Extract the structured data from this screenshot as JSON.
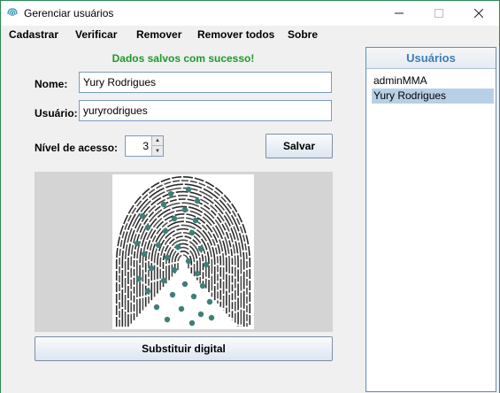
{
  "window": {
    "title": "Gerenciar usuários"
  },
  "menu": {
    "items": [
      "Cadastrar",
      "Verificar",
      "Remover",
      "Remover todos",
      "Sobre"
    ]
  },
  "form": {
    "status_message": "Dados salvos com sucesso!",
    "name_label": "Nome:",
    "name_value": "Yury Rodrigues",
    "username_label": "Usuário:",
    "username_value": "yuryrodrigues",
    "access_label": "Nível de acesso:",
    "access_value": "3",
    "save_label": "Salvar",
    "replace_fingerprint_label": "Substituir digital"
  },
  "users": {
    "header": "Usuários",
    "items": [
      {
        "label": "adminMMA",
        "selected": false
      },
      {
        "label": "Yury Rodrigues",
        "selected": true
      }
    ]
  },
  "colors": {
    "status_green": "#1e9a2a",
    "accent_blue": "#3d7cb8",
    "selection": "#b9cfe6",
    "minutia_marker": "#3f7f78"
  },
  "icons": {
    "app": "fingerprint-icon",
    "minimize": "minimize-icon",
    "maximize": "maximize-icon",
    "close": "close-icon",
    "spin_up": "chevron-up-icon",
    "spin_down": "chevron-down-icon"
  }
}
